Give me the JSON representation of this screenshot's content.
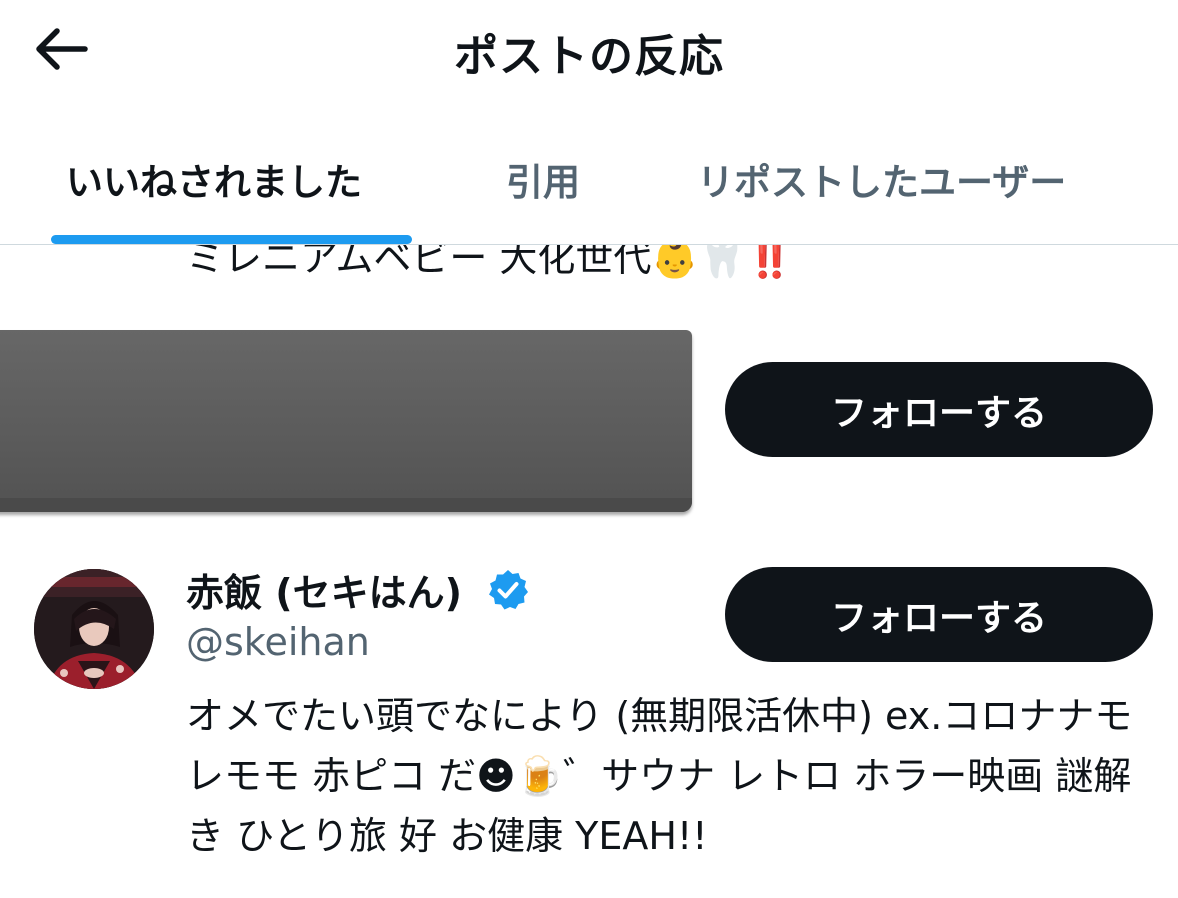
{
  "header": {
    "title": "ポストの反応",
    "back_icon": "arrow-left-icon"
  },
  "tabs": [
    {
      "label": "いいねされました",
      "selected": true
    },
    {
      "label": "引用",
      "selected": false
    },
    {
      "label": "リポストしたユーザー",
      "selected": false
    }
  ],
  "colors": {
    "accent": "#1d9bf0",
    "primary_text": "#0f1419",
    "secondary_text": "#536471",
    "button_bg": "#0f1419"
  },
  "previous_user": {
    "bio_partial": "ミレニアムベビー 大化世代👶🦷‼️",
    "follow_label": "フォローする"
  },
  "user": {
    "display_name": "赤飯 (セキはん)",
    "verified": true,
    "handle": "@skeihan",
    "follow_label": "フォローする",
    "bio": "オメでたい頭でなにより (無期限活休中) ex.コロナナモレモモ 赤ピコ だ☻🍺゛サウナ レトロ ホラー映画 謎解き ひとり旅 好 お健康 YEAH!!"
  }
}
